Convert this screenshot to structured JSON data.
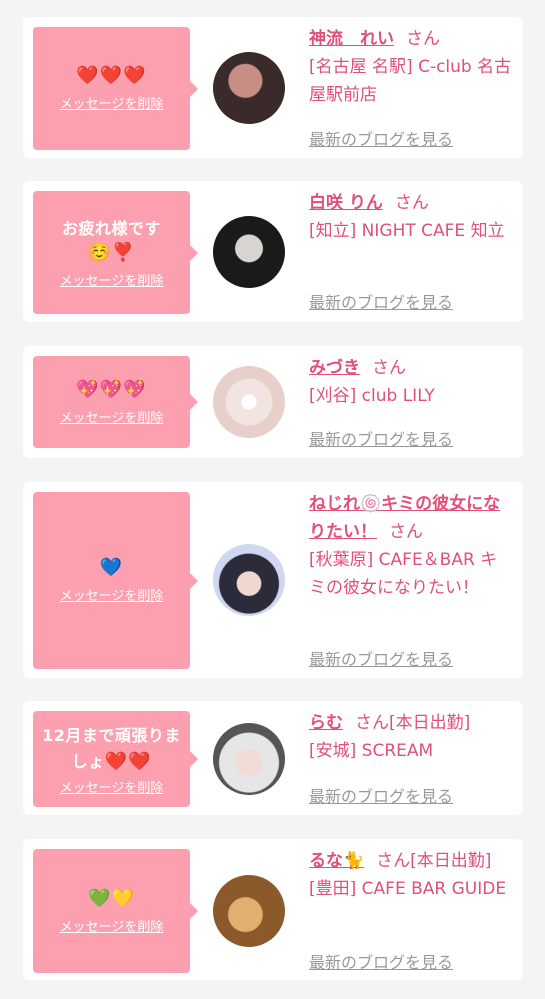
{
  "items": [
    {
      "message": "",
      "hearts": "❤️❤️❤️",
      "delete_label": "メッセージを削除",
      "name": "神流　れい",
      "san": "さん",
      "shop": "[名古屋 名駅] C-club 名古屋駅前店",
      "blog_label": "最新のブログを見る",
      "avatar_colors": [
        "#3a2a2a",
        "#c98e83"
      ]
    },
    {
      "message": "お疲れ様です",
      "hearts": "☺️❣️",
      "delete_label": "メッセージを削除",
      "name": "白咲 りん",
      "san": "さん",
      "shop": "[知立] NIGHT CAFE 知立",
      "blog_label": "最新のブログを見る",
      "avatar_colors": [
        "#1a1a1a",
        "#d8d4d0"
      ]
    },
    {
      "message": "",
      "hearts": "💖💖💖",
      "delete_label": "メッセージを削除",
      "name": "みづき",
      "san": "さん",
      "shop": "[刈谷] club LILY",
      "blog_label": "最新のブログを見る",
      "avatar_colors": [
        "#e8cfc9",
        "#f2e4e0"
      ]
    },
    {
      "message": "",
      "hearts": "💙",
      "delete_label": "メッセージを削除",
      "name": "ねじれ🍥キミの彼女になりたい！",
      "san": "さん",
      "shop": "[秋葉原] CAFE＆BAR キミの彼女になりたい！",
      "blog_label": "最新のブログを見る",
      "avatar_colors": [
        "#2b2b3a",
        "#cfd8f0"
      ]
    },
    {
      "message": "12月まで頑張りましょ",
      "hearts": "❤️❤️",
      "delete_label": "メッセージを削除",
      "name": "らむ",
      "san": "さん[本日出勤]",
      "shop": "[安城] SCREAM",
      "blog_label": "最新のブログを見る",
      "avatar_colors": [
        "#e6e6e6",
        "#555555"
      ]
    },
    {
      "message": "",
      "hearts": "💚💛",
      "delete_label": "メッセージを削除",
      "name": "るな🐈",
      "san": "さん[本日出勤]",
      "shop": "[豊田] CAFE BAR GUIDE",
      "blog_label": "最新のブログを見る",
      "avatar_colors": [
        "#8a5a2a",
        "#e0b070"
      ]
    }
  ]
}
